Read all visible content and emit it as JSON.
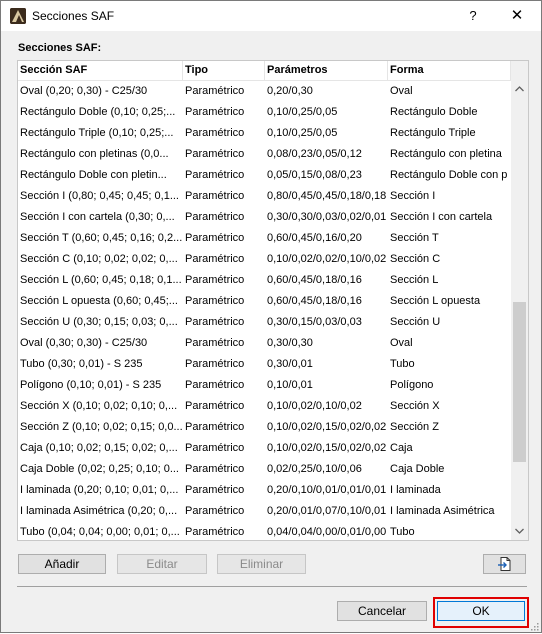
{
  "window": {
    "title": "Secciones SAF"
  },
  "titlebar": {
    "help": "?",
    "close": "✕"
  },
  "section_label": "Secciones SAF:",
  "table": {
    "headers": [
      "Sección SAF",
      "Tipo",
      "Parámetros",
      "Forma"
    ],
    "rows": [
      [
        "Oval (0,20; 0,30) - C25/30",
        "Paramétrico",
        "0,20/0,30",
        "Oval"
      ],
      [
        "Rectángulo Doble (0,10; 0,25;...",
        "Paramétrico",
        "0,10/0,25/0,05",
        "Rectángulo Doble"
      ],
      [
        "Rectángulo Triple (0,10; 0,25;...",
        "Paramétrico",
        "0,10/0,25/0,05",
        "Rectángulo Triple"
      ],
      [
        "Rectángulo con pletinas (0,0...",
        "Paramétrico",
        "0,08/0,23/0,05/0,12",
        "Rectángulo con pletina"
      ],
      [
        "Rectángulo Doble con pletin...",
        "Paramétrico",
        "0,05/0,15/0,08/0,23",
        "Rectángulo Doble con p"
      ],
      [
        "Sección I (0,80; 0,45; 0,45; 0,1...",
        "Paramétrico",
        "0,80/0,45/0,45/0,18/0,18",
        "Sección I"
      ],
      [
        "Sección I con cartela (0,30; 0,...",
        "Paramétrico",
        "0,30/0,30/0,03/0,02/0,01",
        "Sección I con cartela"
      ],
      [
        "Sección T (0,60; 0,45; 0,16; 0,2...",
        "Paramétrico",
        "0,60/0,45/0,16/0,20",
        "Sección T"
      ],
      [
        "Sección C (0,10; 0,02; 0,02; 0,...",
        "Paramétrico",
        "0,10/0,02/0,02/0,10/0,02",
        "Sección C"
      ],
      [
        "Sección L (0,60; 0,45; 0,18; 0,1...",
        "Paramétrico",
        "0,60/0,45/0,18/0,16",
        "Sección L"
      ],
      [
        "Sección L opuesta (0,60; 0,45;...",
        "Paramétrico",
        "0,60/0,45/0,18/0,16",
        "Sección L opuesta"
      ],
      [
        "Sección U (0,30; 0,15; 0,03; 0,...",
        "Paramétrico",
        "0,30/0,15/0,03/0,03",
        "Sección U"
      ],
      [
        "Oval (0,30; 0,30) - C25/30",
        "Paramétrico",
        "0,30/0,30",
        "Oval"
      ],
      [
        "Tubo (0,30; 0,01) - S 235",
        "Paramétrico",
        "0,30/0,01",
        "Tubo"
      ],
      [
        "Polígono (0,10; 0,01) - S 235",
        "Paramétrico",
        "0,10/0,01",
        "Polígono"
      ],
      [
        "Sección X (0,10; 0,02; 0,10; 0,...",
        "Paramétrico",
        "0,10/0,02/0,10/0,02",
        "Sección X"
      ],
      [
        "Sección Z (0,10; 0,02; 0,15; 0,0...",
        "Paramétrico",
        "0,10/0,02/0,15/0,02/0,02",
        "Sección Z"
      ],
      [
        "Caja (0,10; 0,02; 0,15; 0,02; 0,...",
        "Paramétrico",
        "0,10/0,02/0,15/0,02/0,02",
        "Caja"
      ],
      [
        "Caja Doble (0,02; 0,25; 0,10; 0...",
        "Paramétrico",
        "0,02/0,25/0,10/0,06",
        "Caja Doble"
      ],
      [
        "I laminada (0,20; 0,10; 0,01; 0,...",
        "Paramétrico",
        "0,20/0,10/0,01/0,01/0,01",
        "I laminada"
      ],
      [
        "I laminada Asimétrica (0,20; 0,...",
        "Paramétrico",
        "0,20/0,01/0,07/0,10/0,01",
        "I laminada Asimétrica"
      ],
      [
        "Tubo (0,04; 0,04; 0,00; 0,01; 0,...",
        "Paramétrico",
        "0,04/0,04/0,00/0,01/0,00",
        "Tubo"
      ]
    ]
  },
  "buttons": {
    "add": "Añadir",
    "edit": "Editar",
    "delete": "Eliminar",
    "cancel": "Cancelar",
    "ok": "OK"
  },
  "icons": {
    "app": "archicad-app-icon",
    "export": "export-document-icon"
  },
  "colors": {
    "highlight": "#e00000",
    "ok_border": "#0078d7"
  }
}
